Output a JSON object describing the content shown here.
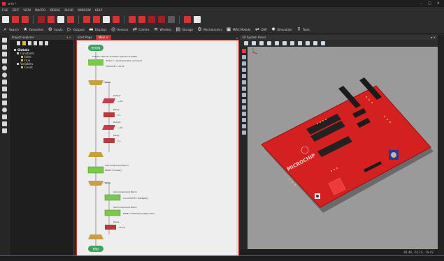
{
  "window": {
    "title": "st-fe *",
    "controls": [
      "–",
      "□",
      "✕"
    ]
  },
  "menu": [
    "FILE",
    "EDIT",
    "VIEW",
    "MACRO",
    "DEBUG",
    "BUILD",
    "WINDOW",
    "HELP"
  ],
  "components_bar": [
    {
      "label": "Search",
      "icon": "search-icon"
    },
    {
      "label": "Favourites",
      "icon": "star-icon"
    },
    {
      "label": "Inputs",
      "icon": "input-icon"
    },
    {
      "label": "Outputs",
      "icon": "output-icon"
    },
    {
      "label": "Displays",
      "icon": "display-icon"
    },
    {
      "label": "Sensors",
      "icon": "sensor-icon"
    },
    {
      "label": "Comms",
      "icon": "comms-icon"
    },
    {
      "label": "Wireless",
      "icon": "wireless-icon"
    },
    {
      "label": "Storage",
      "icon": "storage-icon"
    },
    {
      "label": "Mechatronics",
      "icon": "mechatronics-icon"
    },
    {
      "label": "MIAC Module",
      "icon": "miac-icon"
    },
    {
      "label": "DSP",
      "icon": "dsp-icon"
    },
    {
      "label": "Simulation",
      "icon": "simulation-icon"
    },
    {
      "label": "Tools",
      "icon": "tools-icon"
    }
  ],
  "explorer": {
    "title": "Project explorer",
    "controls": "▾ ✕",
    "tree": [
      {
        "label": "Globals",
        "level": 0,
        "bold": true
      },
      {
        "label": "Constants",
        "level": 1
      },
      {
        "label": "false",
        "level": 2
      },
      {
        "label": "true",
        "level": 2
      },
      {
        "label": "Variables",
        "level": 1
      },
      {
        "label": "Count",
        "level": 2
      }
    ]
  },
  "tabs": [
    {
      "label": "Start Page",
      "active": false
    },
    {
      "label": "Main ✕",
      "active": true
    }
  ],
  "flowchart": {
    "begin": "BEGIN",
    "end": "END",
    "comment1": "Set the internal oscillator speed to 16 MHz",
    "comment2": "Enter C code below this comment",
    "code": "OSCCON = 0x78;",
    "loop1": "While",
    "output1_label": "Output",
    "output1_value": "→ A0",
    "delay1_label": "Delay",
    "delay1_value": "1 s",
    "output2_label": "Output",
    "output2_value": "→ A0",
    "delay2_label": "Delay",
    "delay2_value": "1 s",
    "callcomp1_label": "Call Component Macro",
    "callcomp1_value": "PWM1::Enable()",
    "loop2": "While",
    "callcomp2_label": "Call Component Macro",
    "callcomp2_value": "Count=POT1::GetByte()",
    "callcomp3_label": "Call Component Macro",
    "callcomp3_value": "PWM1::SetDutyCycle8(Count)",
    "delay3_label": "Delay",
    "delay3_value": "15 ms",
    "label_0": "0",
    "label_1": "1"
  },
  "system_panel": {
    "title": "3D System Panel",
    "controls": "▾ ✕",
    "brand": "MICROCHIP",
    "status": "-91.46, -52.15, -78.42"
  },
  "colors": {
    "accent": "#c83232",
    "board": "#d42020",
    "terminator": "#3aa55b",
    "calc": "#7cc84a",
    "output": "#c83a50",
    "delay": "#b83a3a",
    "loop": "#c8a040"
  }
}
